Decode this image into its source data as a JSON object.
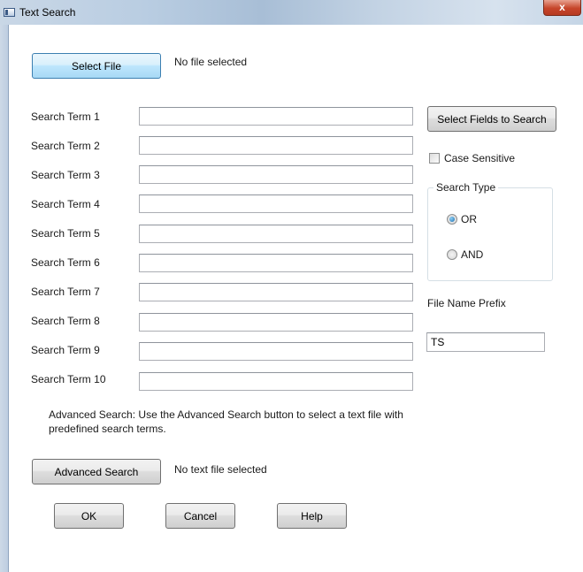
{
  "window": {
    "title": "Text Search",
    "close_glyph": "x"
  },
  "file": {
    "select_label": "Select File",
    "status": "No file selected"
  },
  "search_terms": [
    {
      "label": "Search Term 1",
      "value": ""
    },
    {
      "label": "Search Term 2",
      "value": ""
    },
    {
      "label": "Search Term 3",
      "value": ""
    },
    {
      "label": "Search Term 4",
      "value": ""
    },
    {
      "label": "Search Term 5",
      "value": ""
    },
    {
      "label": "Search Term 6",
      "value": ""
    },
    {
      "label": "Search Term 7",
      "value": ""
    },
    {
      "label": "Search Term 8",
      "value": ""
    },
    {
      "label": "Search Term 9",
      "value": ""
    },
    {
      "label": "Search Term 10",
      "value": ""
    }
  ],
  "options": {
    "select_fields_label": "Select Fields to Search",
    "case_sensitive_label": "Case Sensitive",
    "case_sensitive_checked": false,
    "search_type": {
      "legend": "Search Type",
      "choices": [
        "OR",
        "AND"
      ],
      "selected": "OR"
    },
    "prefix_label": "File Name Prefix",
    "prefix_value": "TS"
  },
  "advanced": {
    "note": "Advanced Search: Use the Advanced Search button to select a text file with predefined search terms.",
    "button_label": "Advanced Search",
    "status": "No text file selected"
  },
  "actions": {
    "ok_label": "OK",
    "cancel_label": "Cancel",
    "help_label": "Help"
  },
  "icons": {
    "window": "window-icon",
    "close": "close-icon"
  },
  "colors": {
    "focus_border": "#3c7fb1",
    "close_red": "#c6452a",
    "title_blue": "#b9cde2"
  }
}
